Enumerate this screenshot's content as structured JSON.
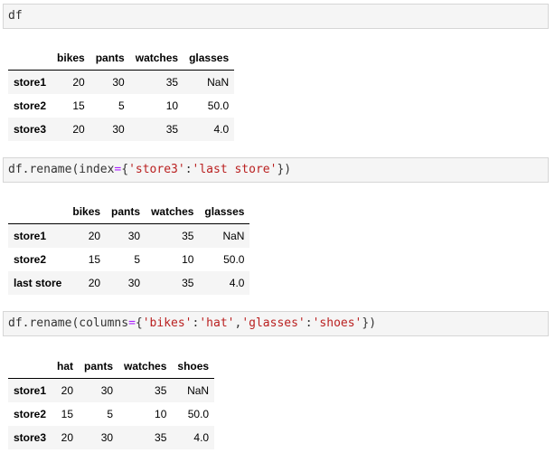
{
  "cells": [
    {
      "code_tokens": [
        {
          "t": "df",
          "c": ""
        }
      ],
      "table": {
        "index_header": "",
        "columns": [
          "bikes",
          "pants",
          "watches",
          "glasses"
        ],
        "rows": [
          {
            "index": "store1",
            "values": [
              "20",
              "30",
              "35",
              "NaN"
            ]
          },
          {
            "index": "store2",
            "values": [
              "15",
              "5",
              "10",
              "50.0"
            ]
          },
          {
            "index": "store3",
            "values": [
              "20",
              "30",
              "35",
              "4.0"
            ]
          }
        ]
      }
    },
    {
      "code_tokens": [
        {
          "t": "df.rename(index",
          "c": ""
        },
        {
          "t": "=",
          "c": "op"
        },
        {
          "t": "{",
          "c": ""
        },
        {
          "t": "'store3'",
          "c": "str"
        },
        {
          "t": ":",
          "c": ""
        },
        {
          "t": "'last store'",
          "c": "str"
        },
        {
          "t": "})",
          "c": ""
        }
      ],
      "table": {
        "index_header": "",
        "columns": [
          "bikes",
          "pants",
          "watches",
          "glasses"
        ],
        "rows": [
          {
            "index": "store1",
            "values": [
              "20",
              "30",
              "35",
              "NaN"
            ]
          },
          {
            "index": "store2",
            "values": [
              "15",
              "5",
              "10",
              "50.0"
            ]
          },
          {
            "index": "last store",
            "values": [
              "20",
              "30",
              "35",
              "4.0"
            ]
          }
        ]
      }
    },
    {
      "code_tokens": [
        {
          "t": "df.rename(columns",
          "c": ""
        },
        {
          "t": "=",
          "c": "op"
        },
        {
          "t": "{",
          "c": ""
        },
        {
          "t": "'bikes'",
          "c": "str"
        },
        {
          "t": ":",
          "c": ""
        },
        {
          "t": "'hat'",
          "c": "str"
        },
        {
          "t": ",",
          "c": ""
        },
        {
          "t": "'glasses'",
          "c": "str"
        },
        {
          "t": ":",
          "c": ""
        },
        {
          "t": "'shoes'",
          "c": "str"
        },
        {
          "t": "})",
          "c": ""
        }
      ],
      "table": {
        "index_header": "",
        "columns": [
          "hat",
          "pants",
          "watches",
          "shoes"
        ],
        "rows": [
          {
            "index": "store1",
            "values": [
              "20",
              "30",
              "35",
              "NaN"
            ]
          },
          {
            "index": "store2",
            "values": [
              "15",
              "5",
              "10",
              "50.0"
            ]
          },
          {
            "index": "store3",
            "values": [
              "20",
              "30",
              "35",
              "4.0"
            ]
          }
        ]
      }
    }
  ],
  "colors": {
    "code_background": "#f5f5f5",
    "code_border": "#d6d6d6",
    "operator": "#aa22ff",
    "string": "#ba2121",
    "striped_row": "#f5f5f5"
  }
}
